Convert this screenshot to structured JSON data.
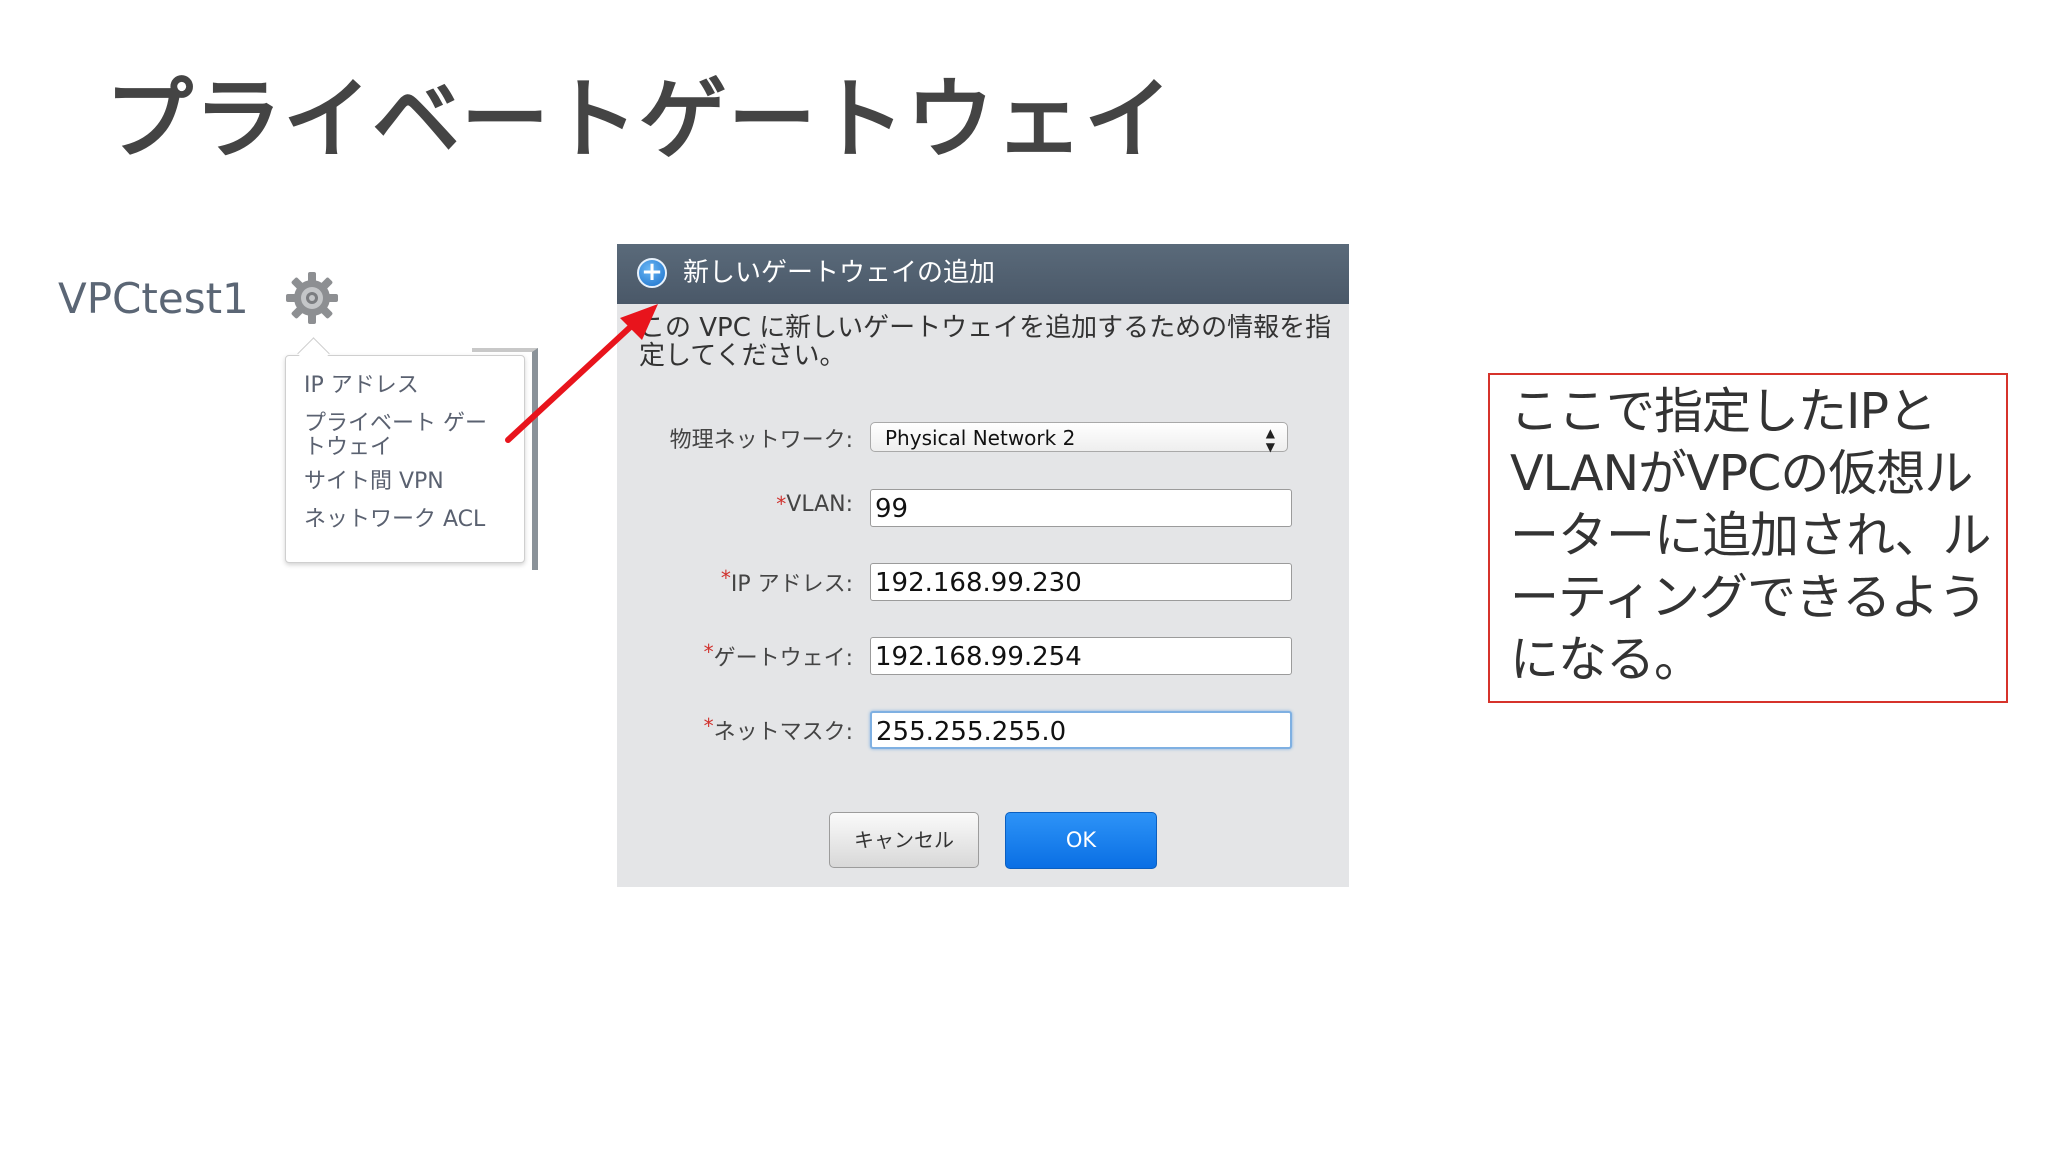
{
  "slide": {
    "title": "プライベートゲートウェイ"
  },
  "vpc": {
    "name": "VPCtest1",
    "settings_icon": "gear-icon"
  },
  "menu": {
    "items": [
      {
        "label": "IP アドレス"
      },
      {
        "label": "プライベート ゲートウェイ"
      },
      {
        "label": "サイト間 VPN"
      },
      {
        "label": "ネットワーク ACL"
      }
    ]
  },
  "dialog": {
    "title": "新しいゲートウェイの追加",
    "icon": "plus-circle-icon",
    "description": "この VPC に新しいゲートウェイを追加するための情報を指定してください。",
    "fields": {
      "physical_network": {
        "label": "物理ネットワーク:",
        "value": "Physical Network 2"
      },
      "vlan": {
        "label": "VLAN:",
        "value": "99",
        "required": true
      },
      "ip_address": {
        "label": "IP アドレス:",
        "value": "192.168.99.230",
        "required": true
      },
      "gateway": {
        "label": "ゲートウェイ:",
        "value": "192.168.99.254",
        "required": true
      },
      "netmask": {
        "label": "ネットマスク:",
        "value": "255.255.255.0",
        "required": true
      }
    },
    "required_mark": "*",
    "buttons": {
      "cancel": "キャンセル",
      "ok": "OK"
    }
  },
  "note": {
    "text": "ここで指定したIPとVLANがVPCの仮想ルーターに追加され、ルーティングできるようになる。"
  },
  "colors": {
    "title_text": "#444444",
    "arrow": "#e8141c",
    "note_border": "#d6332b",
    "ok_button": "#1479ec",
    "dialog_titlebar": "#52606f"
  }
}
